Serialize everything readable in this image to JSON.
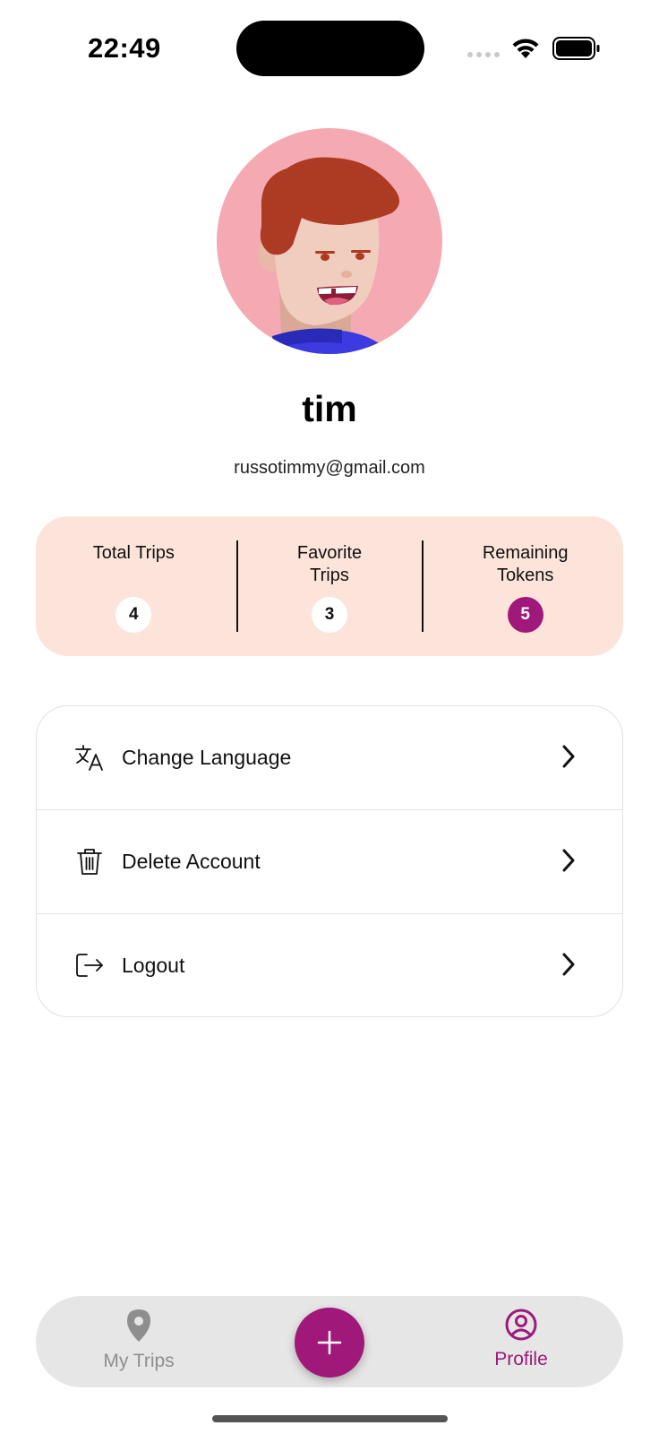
{
  "status_bar": {
    "time": "22:49"
  },
  "profile": {
    "name": "tim",
    "email": "russotimmy@gmail.com"
  },
  "stats": [
    {
      "label": "Total Trips",
      "value": "4"
    },
    {
      "label": "Favorite Trips",
      "value": "3"
    },
    {
      "label": "Remaining Tokens",
      "value": "5"
    }
  ],
  "menu": [
    {
      "label": "Change Language",
      "icon": "translate-icon"
    },
    {
      "label": "Delete Account",
      "icon": "trash-icon"
    },
    {
      "label": "Logout",
      "icon": "logout-icon"
    }
  ],
  "nav": {
    "trips_label": "My Trips",
    "profile_label": "Profile",
    "active": "Profile"
  },
  "colors": {
    "accent": "#a0187a",
    "stats_bg": "#fde4da",
    "nav_bg": "#e6e6e6"
  }
}
